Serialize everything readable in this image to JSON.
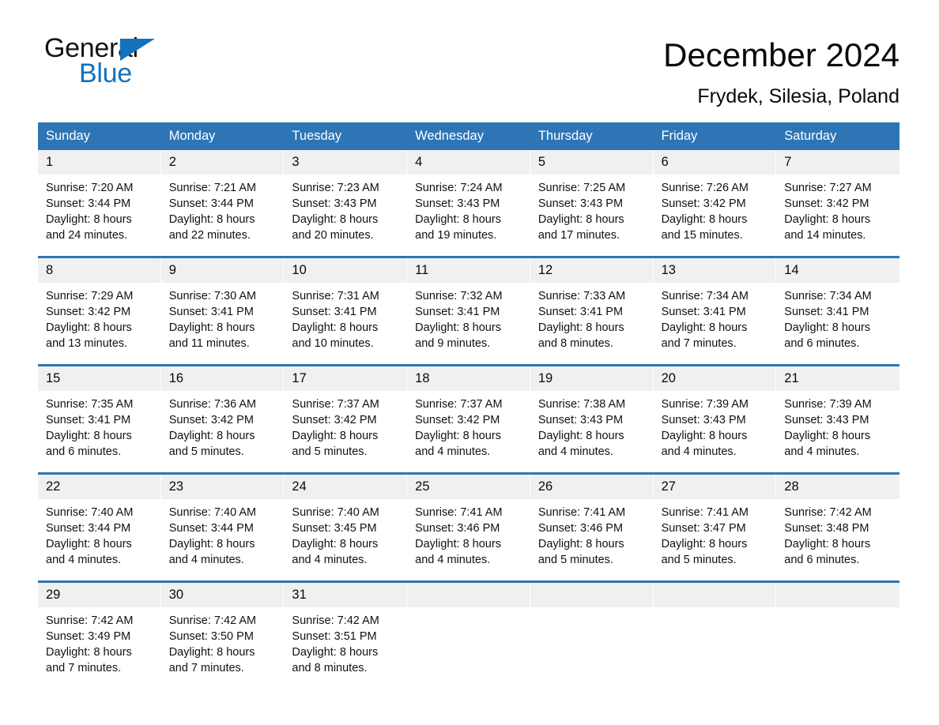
{
  "logo": {
    "word1": "General",
    "word2": "Blue",
    "triangle_color": "#1472BC"
  },
  "header": {
    "title": "December 2024",
    "subtitle": "Frydek, Silesia, Poland"
  },
  "theme": {
    "header_blue": "#2E75B6",
    "day_band_gray": "#F0F0F0",
    "text_black": "#0a0a0a"
  },
  "weekdays": [
    "Sunday",
    "Monday",
    "Tuesday",
    "Wednesday",
    "Thursday",
    "Friday",
    "Saturday"
  ],
  "weeks": [
    {
      "days": [
        {
          "date": "1",
          "sunrise": "Sunrise: 7:20 AM",
          "sunset": "Sunset: 3:44 PM",
          "daylight_line1": "Daylight: 8 hours",
          "daylight_line2": "and 24 minutes."
        },
        {
          "date": "2",
          "sunrise": "Sunrise: 7:21 AM",
          "sunset": "Sunset: 3:44 PM",
          "daylight_line1": "Daylight: 8 hours",
          "daylight_line2": "and 22 minutes."
        },
        {
          "date": "3",
          "sunrise": "Sunrise: 7:23 AM",
          "sunset": "Sunset: 3:43 PM",
          "daylight_line1": "Daylight: 8 hours",
          "daylight_line2": "and 20 minutes."
        },
        {
          "date": "4",
          "sunrise": "Sunrise: 7:24 AM",
          "sunset": "Sunset: 3:43 PM",
          "daylight_line1": "Daylight: 8 hours",
          "daylight_line2": "and 19 minutes."
        },
        {
          "date": "5",
          "sunrise": "Sunrise: 7:25 AM",
          "sunset": "Sunset: 3:43 PM",
          "daylight_line1": "Daylight: 8 hours",
          "daylight_line2": "and 17 minutes."
        },
        {
          "date": "6",
          "sunrise": "Sunrise: 7:26 AM",
          "sunset": "Sunset: 3:42 PM",
          "daylight_line1": "Daylight: 8 hours",
          "daylight_line2": "and 15 minutes."
        },
        {
          "date": "7",
          "sunrise": "Sunrise: 7:27 AM",
          "sunset": "Sunset: 3:42 PM",
          "daylight_line1": "Daylight: 8 hours",
          "daylight_line2": "and 14 minutes."
        }
      ]
    },
    {
      "days": [
        {
          "date": "8",
          "sunrise": "Sunrise: 7:29 AM",
          "sunset": "Sunset: 3:42 PM",
          "daylight_line1": "Daylight: 8 hours",
          "daylight_line2": "and 13 minutes."
        },
        {
          "date": "9",
          "sunrise": "Sunrise: 7:30 AM",
          "sunset": "Sunset: 3:41 PM",
          "daylight_line1": "Daylight: 8 hours",
          "daylight_line2": "and 11 minutes."
        },
        {
          "date": "10",
          "sunrise": "Sunrise: 7:31 AM",
          "sunset": "Sunset: 3:41 PM",
          "daylight_line1": "Daylight: 8 hours",
          "daylight_line2": "and 10 minutes."
        },
        {
          "date": "11",
          "sunrise": "Sunrise: 7:32 AM",
          "sunset": "Sunset: 3:41 PM",
          "daylight_line1": "Daylight: 8 hours",
          "daylight_line2": "and 9 minutes."
        },
        {
          "date": "12",
          "sunrise": "Sunrise: 7:33 AM",
          "sunset": "Sunset: 3:41 PM",
          "daylight_line1": "Daylight: 8 hours",
          "daylight_line2": "and 8 minutes."
        },
        {
          "date": "13",
          "sunrise": "Sunrise: 7:34 AM",
          "sunset": "Sunset: 3:41 PM",
          "daylight_line1": "Daylight: 8 hours",
          "daylight_line2": "and 7 minutes."
        },
        {
          "date": "14",
          "sunrise": "Sunrise: 7:34 AM",
          "sunset": "Sunset: 3:41 PM",
          "daylight_line1": "Daylight: 8 hours",
          "daylight_line2": "and 6 minutes."
        }
      ]
    },
    {
      "days": [
        {
          "date": "15",
          "sunrise": "Sunrise: 7:35 AM",
          "sunset": "Sunset: 3:41 PM",
          "daylight_line1": "Daylight: 8 hours",
          "daylight_line2": "and 6 minutes."
        },
        {
          "date": "16",
          "sunrise": "Sunrise: 7:36 AM",
          "sunset": "Sunset: 3:42 PM",
          "daylight_line1": "Daylight: 8 hours",
          "daylight_line2": "and 5 minutes."
        },
        {
          "date": "17",
          "sunrise": "Sunrise: 7:37 AM",
          "sunset": "Sunset: 3:42 PM",
          "daylight_line1": "Daylight: 8 hours",
          "daylight_line2": "and 5 minutes."
        },
        {
          "date": "18",
          "sunrise": "Sunrise: 7:37 AM",
          "sunset": "Sunset: 3:42 PM",
          "daylight_line1": "Daylight: 8 hours",
          "daylight_line2": "and 4 minutes."
        },
        {
          "date": "19",
          "sunrise": "Sunrise: 7:38 AM",
          "sunset": "Sunset: 3:43 PM",
          "daylight_line1": "Daylight: 8 hours",
          "daylight_line2": "and 4 minutes."
        },
        {
          "date": "20",
          "sunrise": "Sunrise: 7:39 AM",
          "sunset": "Sunset: 3:43 PM",
          "daylight_line1": "Daylight: 8 hours",
          "daylight_line2": "and 4 minutes."
        },
        {
          "date": "21",
          "sunrise": "Sunrise: 7:39 AM",
          "sunset": "Sunset: 3:43 PM",
          "daylight_line1": "Daylight: 8 hours",
          "daylight_line2": "and 4 minutes."
        }
      ]
    },
    {
      "days": [
        {
          "date": "22",
          "sunrise": "Sunrise: 7:40 AM",
          "sunset": "Sunset: 3:44 PM",
          "daylight_line1": "Daylight: 8 hours",
          "daylight_line2": "and 4 minutes."
        },
        {
          "date": "23",
          "sunrise": "Sunrise: 7:40 AM",
          "sunset": "Sunset: 3:44 PM",
          "daylight_line1": "Daylight: 8 hours",
          "daylight_line2": "and 4 minutes."
        },
        {
          "date": "24",
          "sunrise": "Sunrise: 7:40 AM",
          "sunset": "Sunset: 3:45 PM",
          "daylight_line1": "Daylight: 8 hours",
          "daylight_line2": "and 4 minutes."
        },
        {
          "date": "25",
          "sunrise": "Sunrise: 7:41 AM",
          "sunset": "Sunset: 3:46 PM",
          "daylight_line1": "Daylight: 8 hours",
          "daylight_line2": "and 4 minutes."
        },
        {
          "date": "26",
          "sunrise": "Sunrise: 7:41 AM",
          "sunset": "Sunset: 3:46 PM",
          "daylight_line1": "Daylight: 8 hours",
          "daylight_line2": "and 5 minutes."
        },
        {
          "date": "27",
          "sunrise": "Sunrise: 7:41 AM",
          "sunset": "Sunset: 3:47 PM",
          "daylight_line1": "Daylight: 8 hours",
          "daylight_line2": "and 5 minutes."
        },
        {
          "date": "28",
          "sunrise": "Sunrise: 7:42 AM",
          "sunset": "Sunset: 3:48 PM",
          "daylight_line1": "Daylight: 8 hours",
          "daylight_line2": "and 6 minutes."
        }
      ]
    },
    {
      "days": [
        {
          "date": "29",
          "sunrise": "Sunrise: 7:42 AM",
          "sunset": "Sunset: 3:49 PM",
          "daylight_line1": "Daylight: 8 hours",
          "daylight_line2": "and 7 minutes."
        },
        {
          "date": "30",
          "sunrise": "Sunrise: 7:42 AM",
          "sunset": "Sunset: 3:50 PM",
          "daylight_line1": "Daylight: 8 hours",
          "daylight_line2": "and 7 minutes."
        },
        {
          "date": "31",
          "sunrise": "Sunrise: 7:42 AM",
          "sunset": "Sunset: 3:51 PM",
          "daylight_line1": "Daylight: 8 hours",
          "daylight_line2": "and 8 minutes."
        },
        {
          "date": "",
          "sunrise": "",
          "sunset": "",
          "daylight_line1": "",
          "daylight_line2": ""
        },
        {
          "date": "",
          "sunrise": "",
          "sunset": "",
          "daylight_line1": "",
          "daylight_line2": ""
        },
        {
          "date": "",
          "sunrise": "",
          "sunset": "",
          "daylight_line1": "",
          "daylight_line2": ""
        },
        {
          "date": "",
          "sunrise": "",
          "sunset": "",
          "daylight_line1": "",
          "daylight_line2": ""
        }
      ]
    }
  ]
}
